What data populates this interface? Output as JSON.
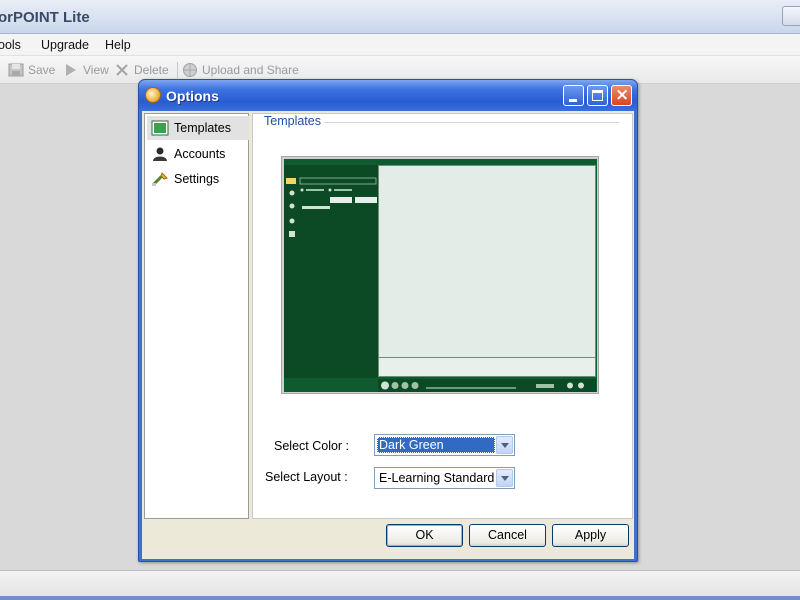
{
  "app": {
    "title": "orPOINT Lite"
  },
  "menu": {
    "items": [
      "Tools",
      "Upgrade",
      "Help"
    ],
    "items_visible_text": [
      "ools",
      "Upgrade",
      "Help"
    ]
  },
  "toolbar": {
    "save_label": "Save",
    "view_label": "View",
    "delete_label": "Delete",
    "upload_label": "Upload and Share"
  },
  "dialog": {
    "title": "Options",
    "nav": [
      {
        "label": "Templates",
        "icon": "template-icon",
        "selected": true
      },
      {
        "label": "Accounts",
        "icon": "user-icon",
        "selected": false
      },
      {
        "label": "Settings",
        "icon": "settings-icon",
        "selected": false
      }
    ],
    "group_label": "Templates",
    "form": {
      "color_label": "Select Color :",
      "color_value": "Dark Green",
      "layout_label": "Select Layout :",
      "layout_value": "E-Learning Standard"
    },
    "buttons": {
      "ok": "OK",
      "cancel": "Cancel",
      "apply": "Apply"
    }
  },
  "colors": {
    "dialog_titlebar": "#2a5bd3",
    "selection": "#316ac5",
    "template_green": "#0f5a2e"
  }
}
